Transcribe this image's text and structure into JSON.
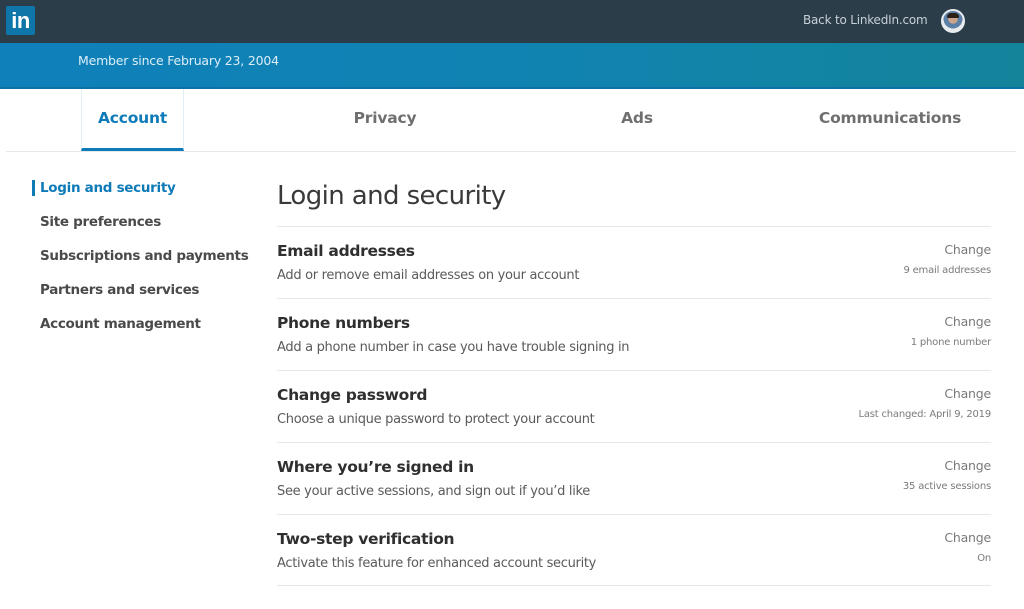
{
  "topbar": {
    "logo_text": "in",
    "back_link": "Back to LinkedIn.com"
  },
  "banner": {
    "member_since": "Member since February 23, 2004"
  },
  "tabs": [
    {
      "label": "Account",
      "active": true
    },
    {
      "label": "Privacy",
      "active": false
    },
    {
      "label": "Ads",
      "active": false
    },
    {
      "label": "Communications",
      "active": false
    }
  ],
  "sidebar": {
    "items": [
      {
        "label": "Login and security",
        "active": true
      },
      {
        "label": "Site preferences",
        "active": false
      },
      {
        "label": "Subscriptions and payments",
        "active": false
      },
      {
        "label": "Partners and services",
        "active": false
      },
      {
        "label": "Account management",
        "active": false
      }
    ]
  },
  "main": {
    "title": "Login and security",
    "rows": [
      {
        "title": "Email addresses",
        "description": "Add or remove email addresses on your account",
        "action": "Change",
        "meta": "9 email addresses"
      },
      {
        "title": "Phone numbers",
        "description": "Add a phone number in case you have trouble signing in",
        "action": "Change",
        "meta": "1 phone number"
      },
      {
        "title": "Change password",
        "description": "Choose a unique password to protect your account",
        "action": "Change",
        "meta": "Last changed: April 9, 2019"
      },
      {
        "title": "Where you’re signed in",
        "description": "See your active sessions, and sign out if you’d like",
        "action": "Change",
        "meta": "35 active sessions"
      },
      {
        "title": "Two-step verification",
        "description": "Activate this feature for enhanced account security",
        "action": "Change",
        "meta": "On"
      }
    ]
  },
  "colors": {
    "topbar_bg": "#2c3d4a",
    "brand_blue": "#0e76a8",
    "accent": "#0e7ab8",
    "banner_start": "#0f80ba",
    "banner_end": "#13849a"
  }
}
